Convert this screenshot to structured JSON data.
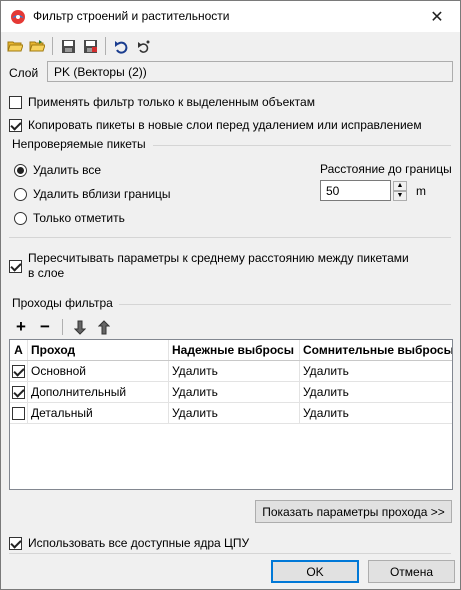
{
  "window": {
    "title": "Фильтр строений и растительности"
  },
  "toolbar": {
    "icons": [
      "open-folder-icon",
      "open-folder-arrow-icon",
      "save-icon",
      "save-as-icon",
      "undo-icon",
      "undo-all-icon"
    ]
  },
  "layer": {
    "label": "Слой",
    "value": "PK (Векторы (2))"
  },
  "options": {
    "apply_selected": {
      "label": "Применять фильтр только к выделенным объектам",
      "checked": false
    },
    "copy_points": {
      "label": "Копировать пикеты в новые слои перед удалением или исправлением",
      "checked": true
    }
  },
  "unverified": {
    "title": "Непроверяемые пикеты",
    "radios": [
      {
        "label": "Удалить все",
        "checked": true
      },
      {
        "label": "Удалить вблизи границы",
        "checked": false
      },
      {
        "label": "Только отметить",
        "checked": false
      }
    ],
    "distance_label": "Расстояние до границы",
    "distance_value": "50",
    "distance_unit": "m"
  },
  "recalc": {
    "label_line1": "Пересчитывать параметры к среднему расстоянию между пикетами",
    "label_line2": "в слое",
    "checked": true
  },
  "passes": {
    "title": "Проходы фильтра",
    "columns": [
      "A",
      "Проход",
      "Надежные выбросы",
      "Сомнительные выбросы"
    ],
    "rows": [
      {
        "active": true,
        "name": "Основной",
        "reliable": "Удалить",
        "doubtful": "Удалить"
      },
      {
        "active": true,
        "name": "Дополнительный",
        "reliable": "Удалить",
        "doubtful": "Удалить"
      },
      {
        "active": false,
        "name": "Детальный",
        "reliable": "Удалить",
        "doubtful": "Удалить"
      }
    ],
    "show_params_label": "Показать параметры прохода >>"
  },
  "use_all_cores": {
    "label": "Использовать все доступные ядра ЦПУ",
    "checked": true
  },
  "buttons": {
    "ok": "OK",
    "cancel": "Отмена"
  }
}
